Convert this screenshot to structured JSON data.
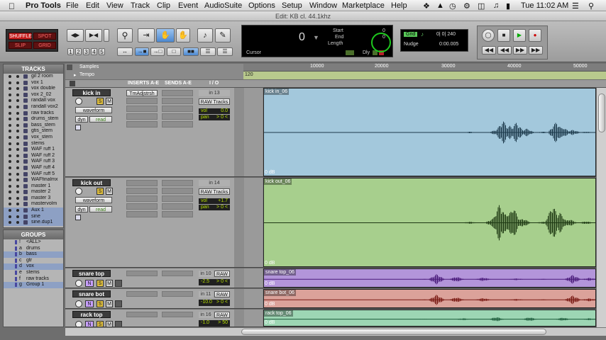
{
  "menubar": {
    "app": "Pro Tools",
    "items": [
      "File",
      "Edit",
      "View",
      "Track",
      "Clip",
      "Event",
      "AudioSuite",
      "Options",
      "Setup",
      "Window",
      "Marketplace",
      "Help"
    ],
    "clock": "Tue 11:02 AM"
  },
  "window": {
    "title": "Edit: KB cl. 44.1khz"
  },
  "toolbar": {
    "mode_shuffle": "SHUFFLE",
    "mode_spot": "SPOT",
    "mode_slip": "SLIP",
    "mode_grid": "GRID",
    "zoom_presets": [
      "1",
      "2",
      "3",
      "4",
      "5"
    ],
    "counter_main": "0",
    "counter_start_label": "Start",
    "counter_end_label": "End",
    "counter_length_label": "Length",
    "counter_start": "0",
    "counter_end": "0",
    "cursor_label": "Cursor",
    "dly_label": "Dly",
    "grid_label": "Grid",
    "grid_value": "0| 0| 240",
    "nudge_label": "Nudge",
    "nudge_value": "0:00.005"
  },
  "tracks_list": {
    "header": "TRACKS",
    "items": [
      "gil 2 room",
      "vox 1",
      "vox double",
      "vox 2_02",
      "randall vox",
      "randall vox2",
      "raw tracks",
      "drums_stem",
      "bass_stem",
      "gtis_stem",
      "vox_stem",
      "stems",
      "WAF ruff 1",
      "WAF ruff 2",
      "WAF ruff 3",
      "WAF ruff 4",
      "WAF ruff 5",
      "WAFfinalmx",
      "master 1",
      "master 2",
      "master 3",
      "mastervolm",
      "Aux 1",
      "sine",
      "sine.dup1"
    ]
  },
  "groups": {
    "header": "GROUPS",
    "items": [
      {
        "letter": "!",
        "name": "<ALL>"
      },
      {
        "letter": "a",
        "name": "drums"
      },
      {
        "letter": "b",
        "name": "bass"
      },
      {
        "letter": "c",
        "name": "gtr"
      },
      {
        "letter": "d",
        "name": "vox"
      },
      {
        "letter": "e",
        "name": "stems"
      },
      {
        "letter": "f",
        "name": "raw tracks"
      },
      {
        "letter": "g",
        "name": "Group 1"
      }
    ]
  },
  "ruler": {
    "samples_label": "Samples",
    "tempo_label": "Tempo",
    "tempo_value": "120",
    "ticks": [
      "10000",
      "20000",
      "30000",
      "40000",
      "50000"
    ]
  },
  "columns": {
    "inserts": "INSERTS A-E",
    "sends": "SENDS A-E",
    "io": "I / O"
  },
  "tracks": [
    {
      "name": "kick in",
      "insert": "TmAdjstrsh",
      "input": "in 13",
      "output": "RAW Tracks",
      "vol": "0.0",
      "pan": "> 0 <",
      "view": "waveform",
      "dyn": "dyn",
      "mode": "read",
      "clip": "kick in_06",
      "gain": "0 dB",
      "color": "#a3c8dc"
    },
    {
      "name": "kick out",
      "insert": "",
      "input": "in 14",
      "output": "RAW Tracks",
      "vol": "+1.7",
      "pan": "> 0 <",
      "view": "waveform",
      "dyn": "dyn",
      "mode": "read",
      "clip": "kick out_06",
      "gain": "0 dB",
      "color": "#a7cf8d"
    },
    {
      "name": "snare top",
      "input": "in 10",
      "output": "RAW",
      "vol": "-2.5",
      "pan": "> 0 <",
      "clip": "snare top_06",
      "gain": "0 dB",
      "color": "#b395da"
    },
    {
      "name": "snare bot",
      "input": "in 11",
      "output": "RAW",
      "vol": "-10.0",
      "pan": "> 0 <",
      "clip": "snare bot_06",
      "gain": "0 dB",
      "color": "#dba29a"
    },
    {
      "name": "rack top",
      "input": "in 16",
      "output": "RAW",
      "vol": "-1.0",
      "pan": "> 50",
      "clip": "rack top_06",
      "gain": "0 dB",
      "color": "#9dd6b4"
    }
  ]
}
